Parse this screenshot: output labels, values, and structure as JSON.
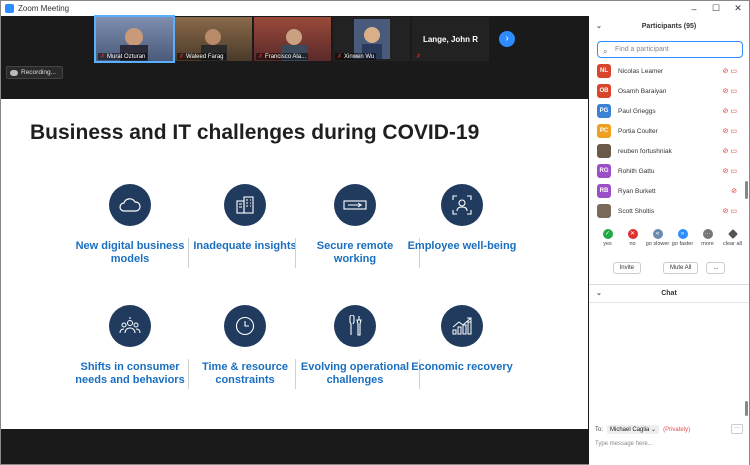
{
  "window": {
    "title": "Zoom Meeting",
    "controls": [
      "–",
      "☐",
      "✕"
    ]
  },
  "meeting": {
    "thumbnails": [
      {
        "name": "Murat Ozturan",
        "bg": "#5a6a8a",
        "active": true
      },
      {
        "name": "Waleed Farag",
        "bg": "#6b4a2a",
        "active": false
      },
      {
        "name": "Francisco Ala...",
        "bg": "#7a3a2a",
        "active": false
      },
      {
        "name": "Xinwen Wu",
        "bg": "#3a4a6a",
        "active": false
      }
    ],
    "name_only_tile": "Lange, John R",
    "recording_label": "Recording..."
  },
  "slide": {
    "title": "Business and IT challenges during COVID-19",
    "tiles": [
      {
        "icon": "cloud-icon",
        "label": "New digital business models"
      },
      {
        "icon": "buildings-icon",
        "label": "Inadequate insights"
      },
      {
        "icon": "remote-access-icon",
        "label": "Secure remote working"
      },
      {
        "icon": "person-frame-icon",
        "label": "Employee well-being"
      },
      {
        "icon": "people-group-icon",
        "label": "Shifts in consumer needs and behaviors"
      },
      {
        "icon": "clock-icon",
        "label": "Time & resource constraints"
      },
      {
        "icon": "tools-icon",
        "label": "Evolving operational challenges"
      },
      {
        "icon": "growth-chart-icon",
        "label": "Economic recovery"
      }
    ]
  },
  "participants": {
    "header": "Participants (95)",
    "search_placeholder": "Find a participant",
    "list": [
      {
        "initials": "NL",
        "name": "Nicolas Leamer",
        "color": "#d9452b"
      },
      {
        "initials": "OB",
        "name": "Osamh Baraiyan",
        "color": "#d9452b"
      },
      {
        "initials": "PG",
        "name": "Paul Grieggs",
        "color": "#3b82d6"
      },
      {
        "initials": "PC",
        "name": "Portia Coulter",
        "color": "#f0a020"
      },
      {
        "initials": "",
        "name": "reuben fortushniak",
        "color": "#6a5a4a"
      },
      {
        "initials": "RG",
        "name": "Rohith Gattu",
        "color": "#9b4fc7"
      },
      {
        "initials": "RB",
        "name": "Ryan Burkett",
        "color": "#9b4fc7"
      },
      {
        "initials": "",
        "name": "Scott Sholtis",
        "color": "#7a6a5a"
      }
    ],
    "reactions": [
      {
        "label": "yes",
        "symbol": "✓",
        "color": "#22a845"
      },
      {
        "label": "no",
        "symbol": "✕",
        "color": "#e03030"
      },
      {
        "label": "go slower",
        "symbol": "«",
        "color": "#2d8cff"
      },
      {
        "label": "go faster",
        "symbol": "»",
        "color": "#2d8cff"
      },
      {
        "label": "more",
        "symbol": "···",
        "color": "#777777"
      },
      {
        "label": "clear all",
        "symbol": "◆",
        "color": "#555555"
      }
    ],
    "buttons": {
      "invite": "Invite",
      "mute_all": "Mute All",
      "more": "..."
    }
  },
  "chat": {
    "header": "Chat",
    "to_label": "To:",
    "recipient": "Michael Caglia",
    "privacy": "(Privately)",
    "more": "···",
    "input_placeholder": "Type message here..."
  }
}
